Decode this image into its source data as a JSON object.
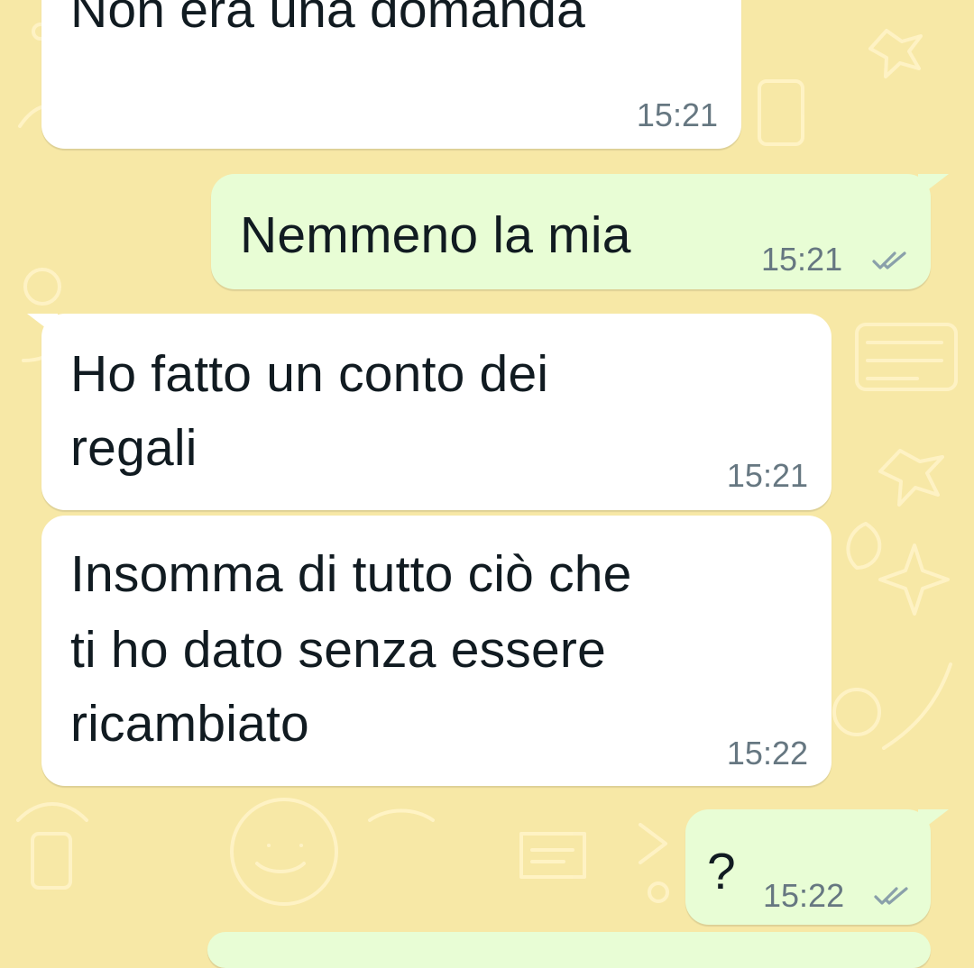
{
  "theme": {
    "wallpaper_color": "#f7e8a6",
    "doodle_color": "#fff4c8",
    "incoming_bubble": "#ffffff",
    "outgoing_bubble": "#e8fdd5",
    "text_color": "#111b21",
    "time_color": "#667781",
    "tick_color": "#8aa0aa"
  },
  "messages": [
    {
      "direction": "incoming",
      "lines": [
        "Non era una domanda"
      ],
      "time": "15:21"
    },
    {
      "direction": "outgoing",
      "lines": [
        "Nemmeno la mia"
      ],
      "time": "15:21",
      "status_icon": "double-check-icon"
    },
    {
      "direction": "incoming",
      "lines": [
        "Ho fatto un conto dei",
        "regali"
      ],
      "time": "15:21"
    },
    {
      "direction": "incoming",
      "lines": [
        "Insomma di tutto ciò che",
        "ti ho dato senza essere",
        "ricambiato"
      ],
      "time": "15:22"
    },
    {
      "direction": "outgoing",
      "lines": [
        "?"
      ],
      "time": "15:22",
      "status_icon": "double-check-icon"
    }
  ]
}
